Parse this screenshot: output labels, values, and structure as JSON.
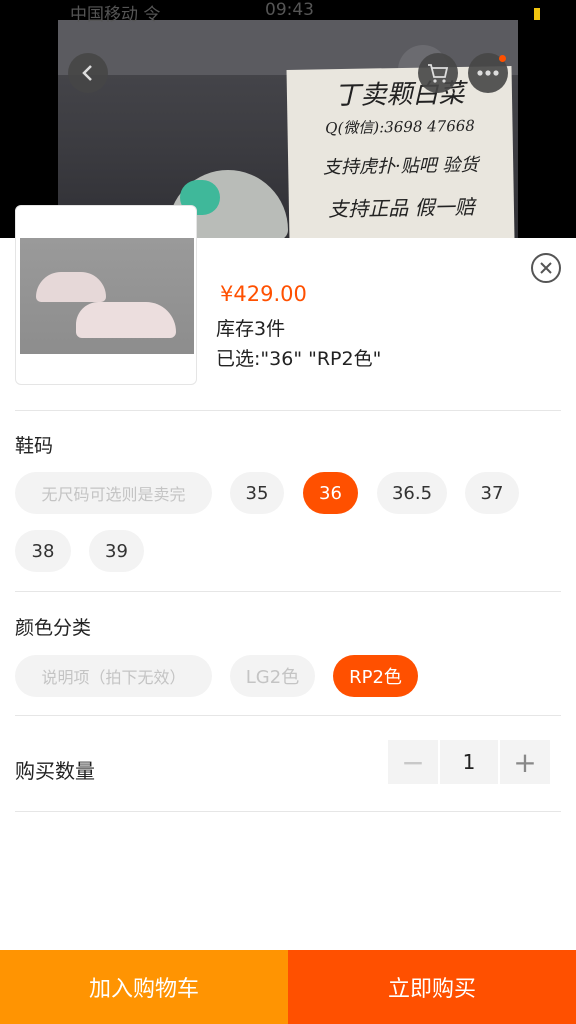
{
  "status_bar": {
    "carrier": "中国移动 令",
    "time": "09:43",
    "battery": ""
  },
  "icons": {
    "back": "chevron-left-icon",
    "cart": "cart-icon",
    "more": "more-icon",
    "close": "close-icon",
    "minus": "minus-icon",
    "plus": "plus-icon"
  },
  "photo_sign": {
    "line1": "丁卖颗白菜",
    "line2": "Q(微信):3698 47668",
    "line3": "支持虎扑·贴吧 验货",
    "line4": "支持正品 假一赔"
  },
  "sku": {
    "price": "¥429.00",
    "stock": "库存3件",
    "selected": "已选:\"36\" \"RP2色\""
  },
  "size_section": {
    "title": "鞋码",
    "options": [
      {
        "label": "无尺码可选则是卖完",
        "state": "disabled"
      },
      {
        "label": "35",
        "state": "normal"
      },
      {
        "label": "36",
        "state": "active"
      },
      {
        "label": "36.5",
        "state": "normal"
      },
      {
        "label": "37",
        "state": "normal"
      },
      {
        "label": "38",
        "state": "normal"
      },
      {
        "label": "39",
        "state": "normal"
      }
    ]
  },
  "color_section": {
    "title": "颜色分类",
    "options": [
      {
        "label": "说明项（拍下无效）",
        "state": "disabled"
      },
      {
        "label": "LG2色",
        "state": "disabled"
      },
      {
        "label": "RP2色",
        "state": "active"
      }
    ]
  },
  "quantity": {
    "label": "购买数量",
    "value": "1",
    "minus": "−",
    "plus": "+"
  },
  "footer": {
    "add_to_cart": "加入购物车",
    "buy_now": "立即购买"
  },
  "colors": {
    "accent": "#ff5000",
    "secondary": "#ff9402",
    "chip_bg": "#f3f3f3"
  }
}
